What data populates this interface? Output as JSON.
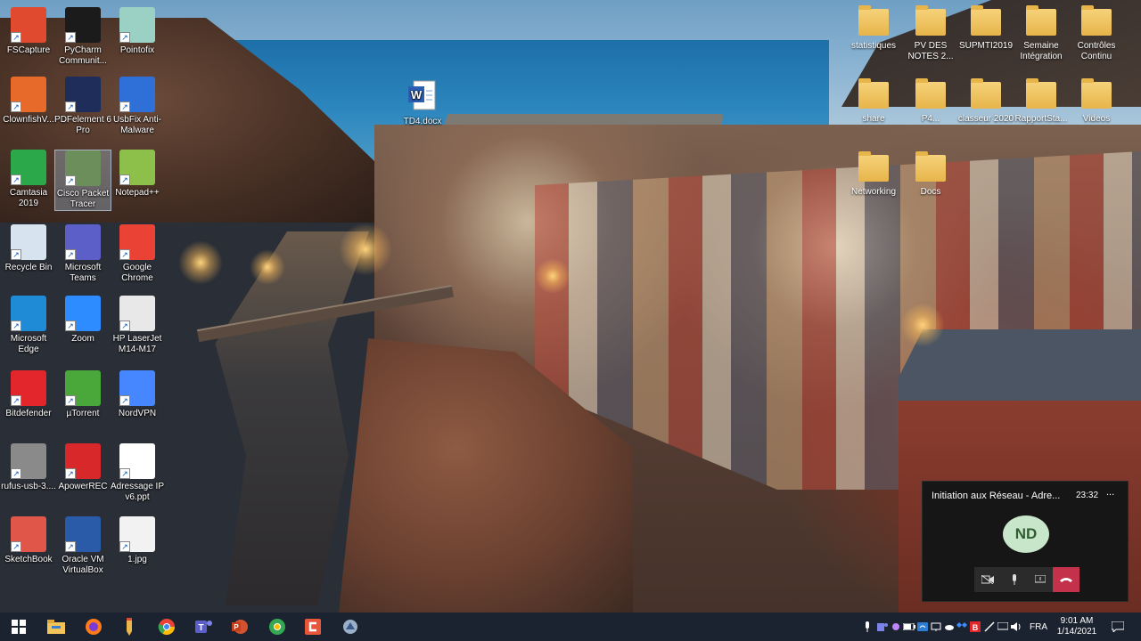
{
  "desktop": {
    "icons": [
      {
        "label": "FSCapture",
        "color": "#e04a2f",
        "icon": "fscapture-icon"
      },
      {
        "label": "PyCharm Communit...",
        "color": "#1b1b1b",
        "icon": "pycharm-icon"
      },
      {
        "label": "Pointofix",
        "color": "#9bd0c4",
        "icon": "pointofix-icon"
      },
      {
        "label": "ClownfishV...",
        "color": "#e86a2a",
        "icon": "clownfish-icon"
      },
      {
        "label": "PDFelement 6 Pro",
        "color": "#1f2d5a",
        "icon": "pdfelement-icon"
      },
      {
        "label": "UsbFix Anti-Malware",
        "color": "#2e6fd8",
        "icon": "usbfix-icon"
      },
      {
        "label": "Camtasia 2019",
        "color": "#2aa84a",
        "icon": "camtasia-icon"
      },
      {
        "label": "Cisco Packet Tracer",
        "color": "#6b8e5a",
        "icon": "cisco-packet-tracer-icon"
      },
      {
        "label": "Notepad++",
        "color": "#8cc04a",
        "icon": "notepadpp-icon"
      },
      {
        "label": "Recycle Bin",
        "color": "#d7e3ee",
        "icon": "recycle-bin-icon"
      },
      {
        "label": "Microsoft Teams",
        "color": "#5b5fc7",
        "icon": "teams-icon"
      },
      {
        "label": "Google Chrome",
        "color": "#ea4335",
        "icon": "chrome-icon"
      },
      {
        "label": "Microsoft Edge",
        "color": "#1f8ad6",
        "icon": "edge-icon"
      },
      {
        "label": "Zoom",
        "color": "#2d8cff",
        "icon": "zoom-icon"
      },
      {
        "label": "HP LaserJet M14-M17",
        "color": "#e8e8e8",
        "icon": "printer-icon"
      },
      {
        "label": "Bitdefender",
        "color": "#e3262b",
        "icon": "bitdefender-icon"
      },
      {
        "label": "µTorrent",
        "color": "#4aa83a",
        "icon": "utorrent-icon"
      },
      {
        "label": "NordVPN",
        "color": "#4687ff",
        "icon": "nordvpn-icon"
      },
      {
        "label": "rufus-usb-3....",
        "color": "#8a8a8a",
        "icon": "rufus-icon"
      },
      {
        "label": "ApowerREC",
        "color": "#d8282a",
        "icon": "apowerrec-icon"
      },
      {
        "label": "Adressage IP v6.ppt",
        "color": "#ffffff",
        "icon": "ppt-file-icon"
      },
      {
        "label": "SketchBook",
        "color": "#e0574a",
        "icon": "sketchbook-icon"
      },
      {
        "label": "Oracle VM VirtualBox",
        "color": "#2a5ba8",
        "icon": "virtualbox-icon"
      },
      {
        "label": "1.jpg",
        "color": "#f2f2f2",
        "icon": "image-file-icon"
      }
    ],
    "word_file": {
      "label": "TD4.docx",
      "icon": "word-doc-icon"
    },
    "folders": [
      {
        "label": "statistiques"
      },
      {
        "label": "PV DES NOTES 2..."
      },
      {
        "label": "SUPMTI2019"
      },
      {
        "label": "Semaine Intégration"
      },
      {
        "label": "Contrôles Continu"
      },
      {
        "label": "share"
      },
      {
        "label": "P4..."
      },
      {
        "label": "classeur 2020"
      },
      {
        "label": "RapportSta..."
      },
      {
        "label": "Videos"
      },
      {
        "label": "Networking"
      },
      {
        "label": "Docs"
      }
    ]
  },
  "call_window": {
    "title": "Initiation aux Réseau - Adre...",
    "duration": "23:32",
    "more": "...",
    "avatar_initials": "ND",
    "avatar_color": "#c8e6c9"
  },
  "taskbar": {
    "lang": "FRA",
    "time": "9:01 AM",
    "date": "1/14/2021",
    "apps": [
      "start-button",
      "file-explorer-icon",
      "firefox-icon",
      "pencil-app-icon",
      "chrome-icon",
      "teams-icon",
      "powerpoint-icon",
      "chrome-alt-icon",
      "camtasia-taskbar-icon",
      "recorder-icon"
    ]
  }
}
